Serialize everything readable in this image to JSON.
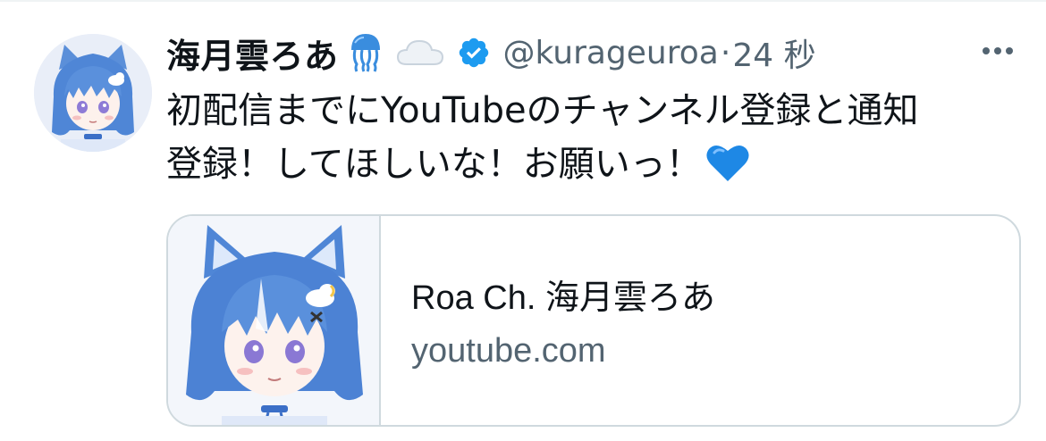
{
  "tweet": {
    "author": {
      "display_name": "海月雲ろあ",
      "name_emojis": [
        "jellyfish-emoji",
        "cloud-emoji"
      ],
      "verified": true,
      "handle": "@kurageuroa",
      "separator": "·",
      "time": "24 秒"
    },
    "text_lines": [
      "初配信までにYouTubeのチャンネル登録と通知",
      "登録！してほしいな！お願いっ！"
    ],
    "text_trailing_emoji": "blue-heart",
    "card": {
      "title": "Roa Ch. 海月雲ろあ",
      "domain": "youtube.com"
    }
  },
  "colors": {
    "text_primary": "#0f1419",
    "text_secondary": "#536471",
    "verified_blue": "#1d9bf0",
    "border": "#cfd9de",
    "heart_blue": "#1e88e5"
  }
}
